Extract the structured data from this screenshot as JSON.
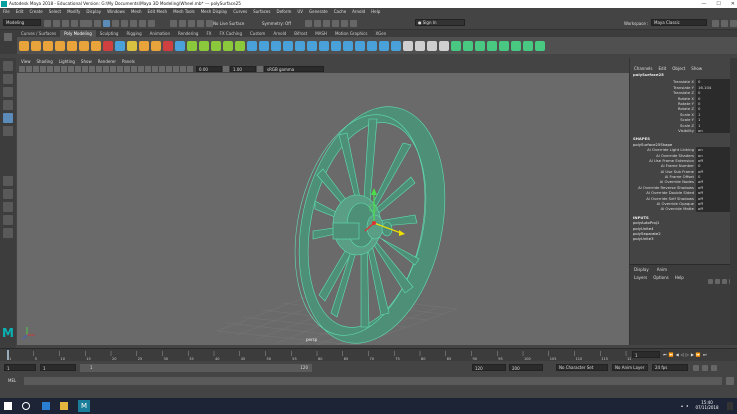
{
  "titlebar": {
    "title": "Autodesk Maya 2018 - Educational Version: G:\\My Documents\\Maya 3D Modeling\\Wheel.mb* --- polySurface25"
  },
  "menubar": {
    "items": [
      "File",
      "Edit",
      "Create",
      "Select",
      "Modify",
      "Display",
      "Windows",
      "Mesh",
      "Edit Mesh",
      "Mesh Tools",
      "Mesh Display",
      "Curves",
      "Surfaces",
      "Deform",
      "UV",
      "Generate",
      "Cache",
      "Arnold",
      "Help"
    ]
  },
  "statusline": {
    "mode": "Modeling",
    "no_live": "No Live Surface",
    "symmetry": "Symmetry: Off",
    "signin": "Sign In",
    "workspace_label": "Workspace :",
    "workspace_value": "Maya Classic"
  },
  "shelf": {
    "tabs": [
      "Curves / Surfaces",
      "Poly Modeling",
      "Sculpting",
      "Rigging",
      "Animation",
      "Rendering",
      "FX",
      "FX Caching",
      "Custom",
      "Arnold",
      "Bifrost",
      "MASH",
      "Motion Graphics",
      "XGen"
    ],
    "active": "Poly Modeling"
  },
  "viewport": {
    "menu": [
      "View",
      "Shading",
      "Lighting",
      "Show",
      "Renderer",
      "Panels"
    ],
    "value_a": "0.00",
    "value_b": "1.00",
    "colorspace": "sRGB gamma",
    "camera_label": "persp",
    "colors": {
      "bg": "#6a6a6a",
      "wire": "#5fe0b4",
      "fill": "#4e8f78",
      "grid": "#777777"
    }
  },
  "channelbox": {
    "tabs": [
      "Channels",
      "Edit",
      "Object",
      "Show"
    ],
    "object_name": "polySurface25",
    "attrs": [
      {
        "k": "Translate X",
        "v": "0"
      },
      {
        "k": "Translate Y",
        "v": "16.104"
      },
      {
        "k": "Translate Z",
        "v": "0"
      },
      {
        "k": "Rotate X",
        "v": "0"
      },
      {
        "k": "Rotate Y",
        "v": "0"
      },
      {
        "k": "Rotate Z",
        "v": "0"
      },
      {
        "k": "Scale X",
        "v": "1"
      },
      {
        "k": "Scale Y",
        "v": "1"
      },
      {
        "k": "Scale Z",
        "v": "1"
      },
      {
        "k": "Visibility",
        "v": "on"
      }
    ],
    "shapes_header": "SHAPES",
    "shape_name": "polySurface25Shape",
    "shape_attrs": [
      {
        "k": "Ai Override Light Linking",
        "v": "on"
      },
      {
        "k": "Ai Override Shaders",
        "v": "on"
      },
      {
        "k": "Ai Use Frame Extension",
        "v": "off"
      },
      {
        "k": "Ai Frame Number",
        "v": "0"
      },
      {
        "k": "Ai Use Sub Frame",
        "v": "off"
      },
      {
        "k": "Ai Frame Offset",
        "v": "0"
      },
      {
        "k": "Ai Override Nodes",
        "v": "off"
      },
      {
        "k": "Ai Override Reverse Shadows",
        "v": "off"
      },
      {
        "k": "Ai Override Double Sided",
        "v": "off"
      },
      {
        "k": "Ai Override Self Shadows",
        "v": "off"
      },
      {
        "k": "Ai Override Opaque",
        "v": "off"
      },
      {
        "k": "Ai Override Matte",
        "v": "off"
      }
    ],
    "inputs_header": "INPUTS",
    "inputs": [
      "polyAutoProj1",
      "polyUnite4",
      "polySeparate2",
      "polyUnite3"
    ],
    "layer_tabs": [
      "Display",
      "Anim"
    ],
    "layer_menu": [
      "Layers",
      "Options",
      "Help"
    ]
  },
  "timeline": {
    "ticks": [
      "1",
      "5",
      "10",
      "15",
      "20",
      "25",
      "30",
      "35",
      "40",
      "45",
      "50",
      "55",
      "60",
      "65",
      "70",
      "75",
      "80",
      "85",
      "90",
      "95",
      "100",
      "105",
      "110",
      "115",
      "120"
    ],
    "current": "1"
  },
  "range": {
    "start": "1",
    "start2": "1",
    "slider_start": "1",
    "slider_end": "120",
    "end": "120",
    "end2": "200",
    "char_set": "No Character Set",
    "anim_layer": "No Anim Layer",
    "fps": "24 fps"
  },
  "mel": {
    "label": "MEL"
  },
  "taskbar": {
    "time": "15:40",
    "date": "07/11/2018"
  }
}
